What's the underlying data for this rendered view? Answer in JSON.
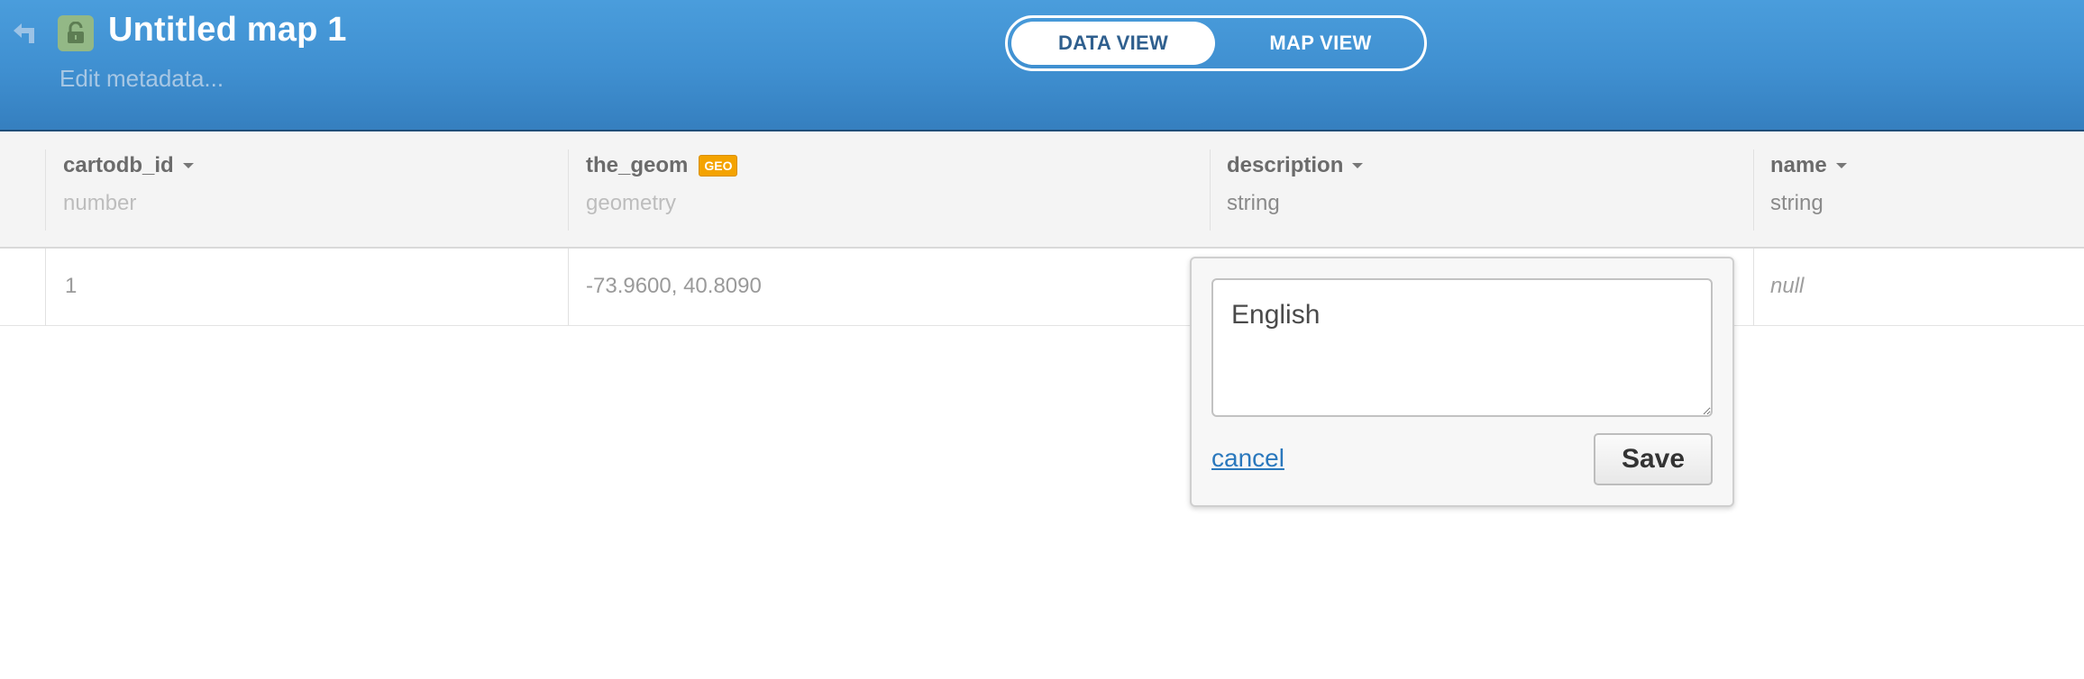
{
  "header": {
    "title": "Untitled map 1",
    "edit_metadata": "Edit metadata...",
    "views": {
      "data_view": "DATA VIEW",
      "map_view": "MAP VIEW",
      "active": "data_view"
    },
    "colors": {
      "background": "#4a9ddc",
      "lock_badge": "#93b886"
    }
  },
  "table": {
    "columns": [
      {
        "name": "cartodb_id",
        "type": "number",
        "has_menu": true
      },
      {
        "name": "the_geom",
        "type": "geometry",
        "badge": "GEO",
        "has_menu": false
      },
      {
        "name": "description",
        "type": "string",
        "has_menu": true
      },
      {
        "name": "name",
        "type": "string",
        "has_menu": true
      }
    ],
    "rows": [
      {
        "cartodb_id": "1",
        "the_geom": "-73.9600, 40.8090",
        "description": "English",
        "name": "null"
      }
    ]
  },
  "editor": {
    "value": "English",
    "cancel_label": "cancel",
    "save_label": "Save"
  },
  "icons": {
    "back": "back-arrow-icon",
    "lock": "unlocked-lock-icon",
    "caret": "caret-down-icon",
    "resize": "resize-handle-icon"
  }
}
